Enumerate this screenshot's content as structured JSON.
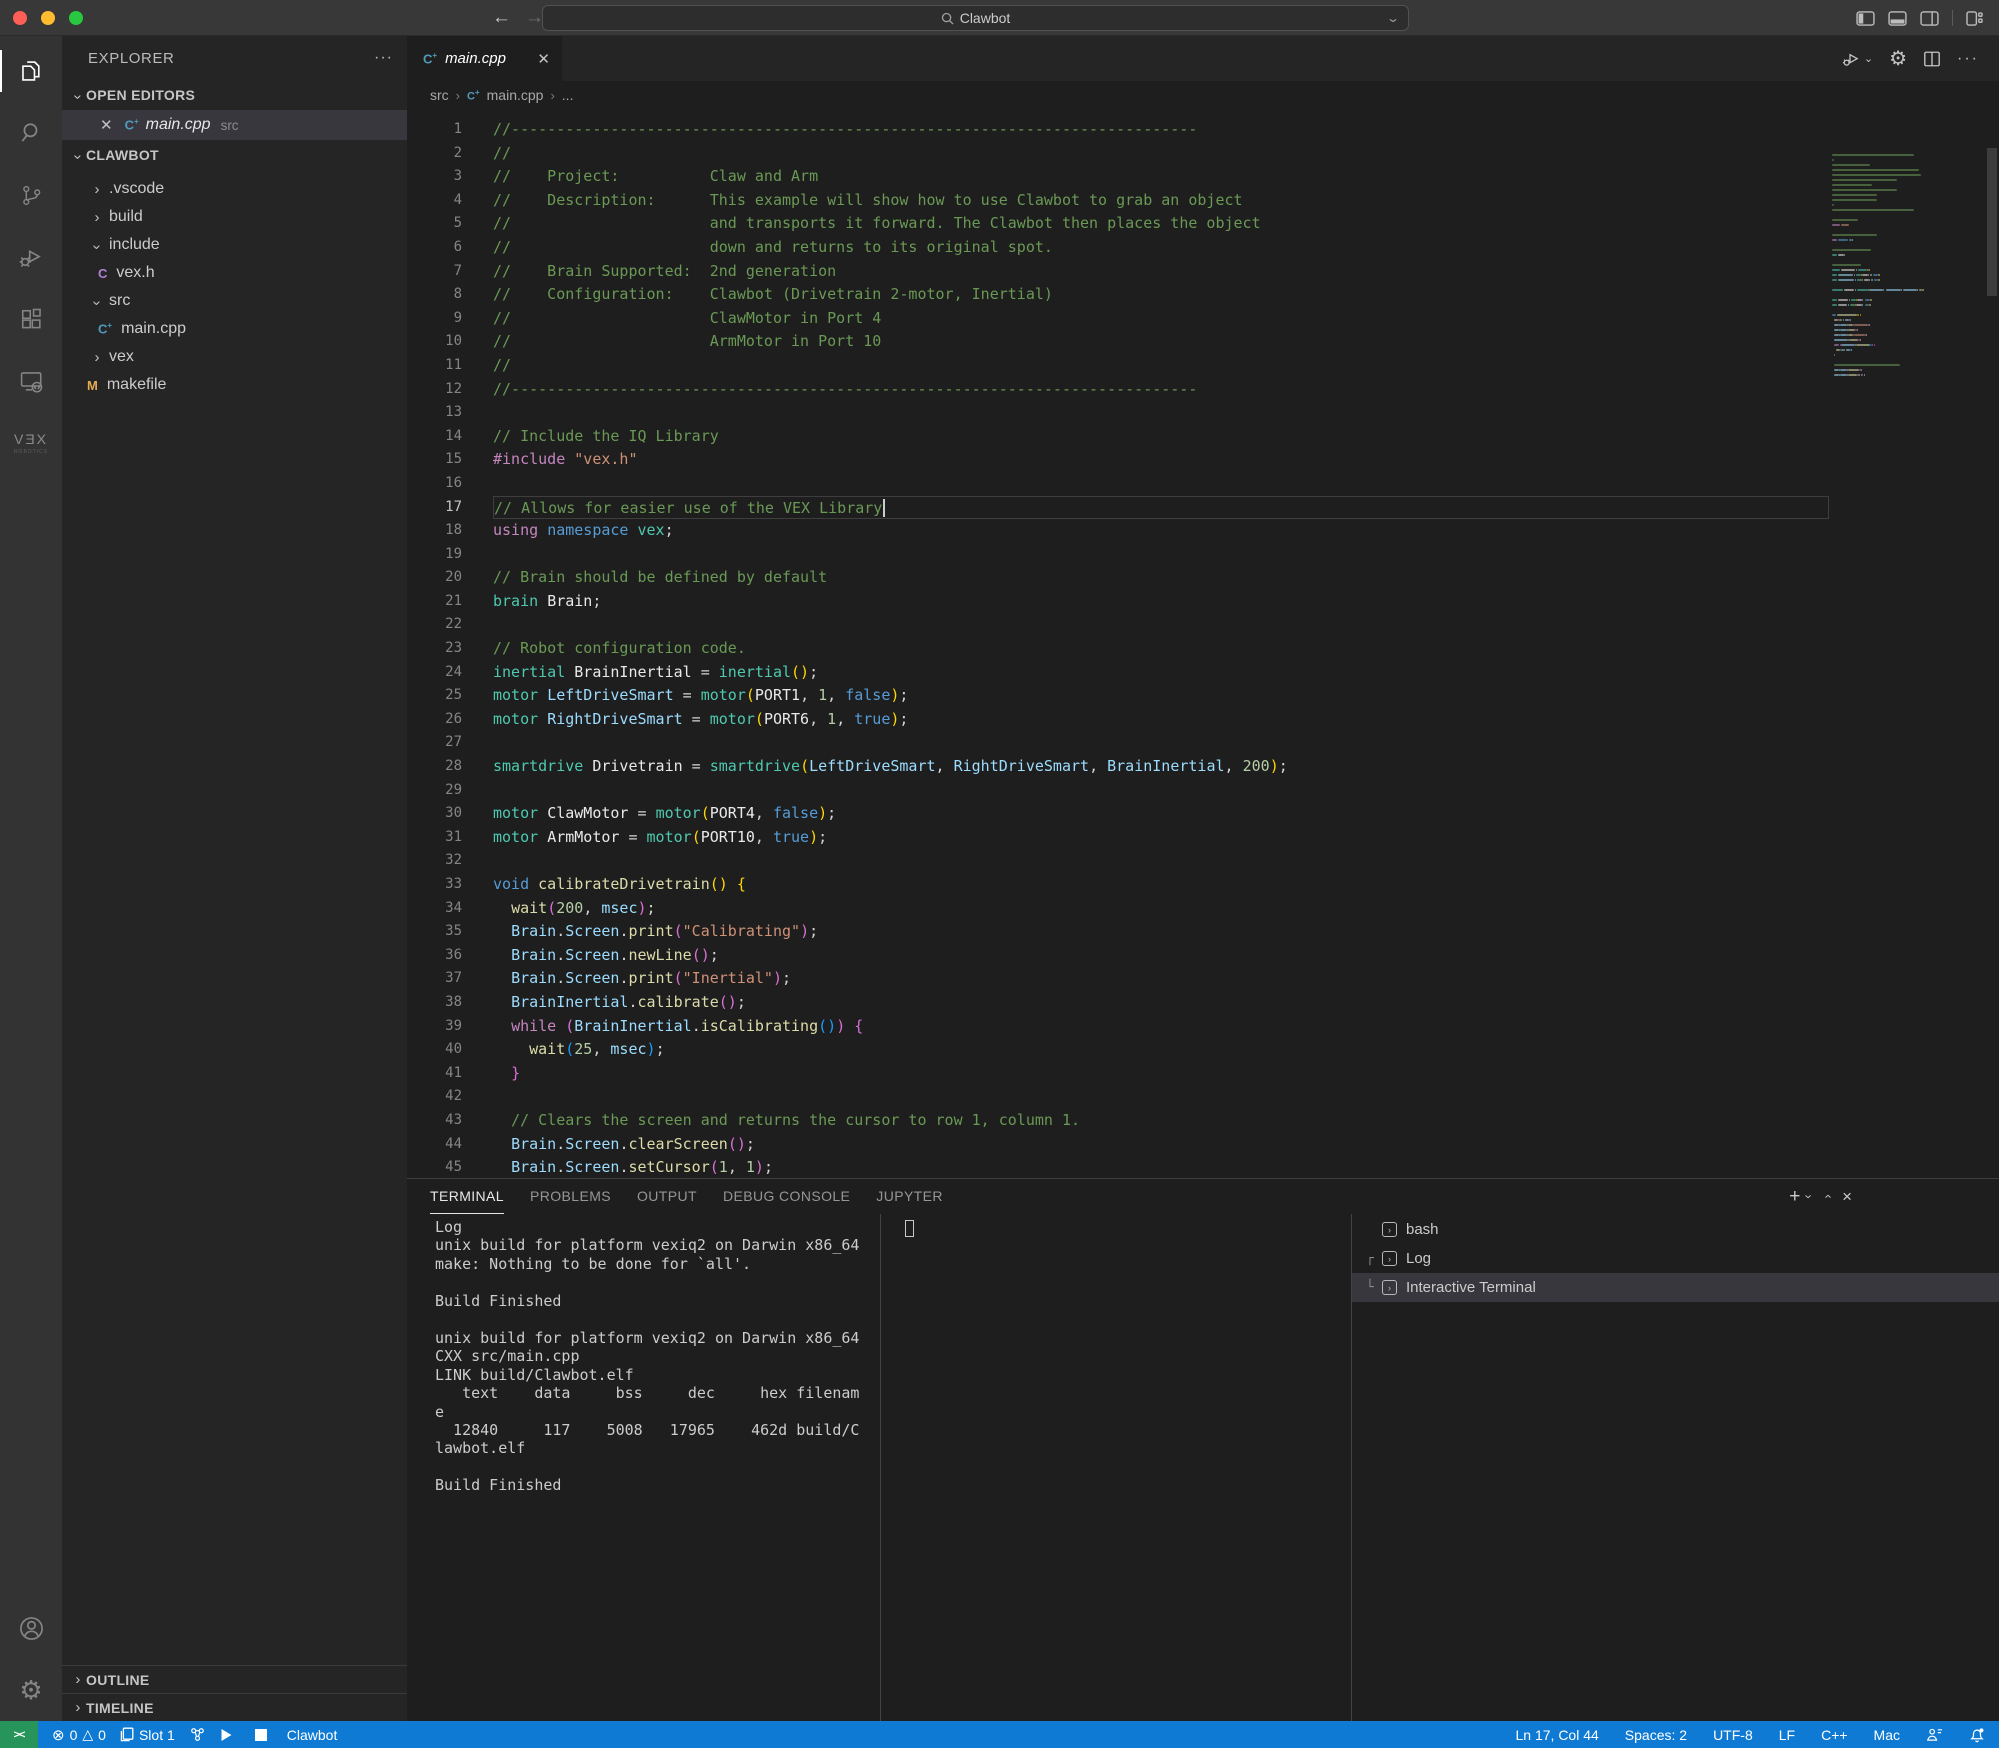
{
  "titlebar": {
    "search_value": "Clawbot"
  },
  "sidebar": {
    "title": "EXPLORER",
    "more_label": "···",
    "sections": {
      "open_editors": "OPEN EDITORS",
      "project": "CLAWBOT",
      "outline": "OUTLINE",
      "timeline": "TIMELINE"
    },
    "open_editor": {
      "file": "main.cpp",
      "path": "src"
    },
    "tree": [
      {
        "label": ".vscode",
        "type": "folder",
        "expanded": false
      },
      {
        "label": "build",
        "type": "folder",
        "expanded": false
      },
      {
        "label": "include",
        "type": "folder",
        "expanded": true
      },
      {
        "label": "vex.h",
        "type": "file",
        "icon": "c",
        "depth": 1
      },
      {
        "label": "src",
        "type": "folder",
        "expanded": true
      },
      {
        "label": "main.cpp",
        "type": "file",
        "icon": "cpp",
        "depth": 1
      },
      {
        "label": "vex",
        "type": "folder",
        "expanded": false
      },
      {
        "label": "makefile",
        "type": "file",
        "icon": "m",
        "depth": 0
      }
    ]
  },
  "editor": {
    "tab": {
      "file": "main.cpp"
    },
    "breadcrumbs": {
      "0": "src",
      "1": "main.cpp",
      "2": "..."
    },
    "cursor_line": 17,
    "lines": [
      [
        [
          "cm",
          "//----------------------------------------------------------------------------"
        ]
      ],
      [
        [
          "cm",
          "//"
        ]
      ],
      [
        [
          "cm",
          "//    Project:          Claw and Arm"
        ]
      ],
      [
        [
          "cm",
          "//    Description:      This example will show how to use Clawbot to grab an object"
        ]
      ],
      [
        [
          "cm",
          "//                      and transports it forward. The Clawbot then places the object"
        ]
      ],
      [
        [
          "cm",
          "//                      down and returns to its original spot."
        ]
      ],
      [
        [
          "cm",
          "//    Brain Supported:  2nd generation"
        ]
      ],
      [
        [
          "cm",
          "//    Configuration:    Clawbot (Drivetrain 2-motor, Inertial)"
        ]
      ],
      [
        [
          "cm",
          "//                      ClawMotor in Port 4"
        ]
      ],
      [
        [
          "cm",
          "//                      ArmMotor in Port 10"
        ]
      ],
      [
        [
          "cm",
          "//"
        ]
      ],
      [
        [
          "cm",
          "//----------------------------------------------------------------------------"
        ]
      ],
      [],
      [
        [
          "cm",
          "// Include the IQ Library"
        ]
      ],
      [
        [
          "kw",
          "#include"
        ],
        [
          "pl",
          " "
        ],
        [
          "st",
          "\"vex.h\""
        ]
      ],
      [],
      [
        [
          "cm",
          "// Allows for easier use of the VEX Library"
        ]
      ],
      [
        [
          "kw",
          "using"
        ],
        [
          "pl",
          " "
        ],
        [
          "kb",
          "namespace"
        ],
        [
          "pl",
          " "
        ],
        [
          "ty",
          "vex"
        ],
        [
          "pl",
          ";"
        ]
      ],
      [],
      [
        [
          "cm",
          "// Brain should be defined by default"
        ]
      ],
      [
        [
          "ty",
          "brain"
        ],
        [
          "pl",
          " "
        ],
        [
          "vw",
          "Brain"
        ],
        [
          "pl",
          ";"
        ]
      ],
      [],
      [
        [
          "cm",
          "// Robot configuration code."
        ]
      ],
      [
        [
          "ty",
          "inertial"
        ],
        [
          "pl",
          " "
        ],
        [
          "vw",
          "BrainInertial"
        ],
        [
          "pl",
          " = "
        ],
        [
          "ty",
          "inertial"
        ],
        [
          "b1",
          "()"
        ],
        [
          "pl",
          ";"
        ]
      ],
      [
        [
          "ty",
          "motor"
        ],
        [
          "pl",
          " "
        ],
        [
          "vb",
          "LeftDriveSmart"
        ],
        [
          "pl",
          " = "
        ],
        [
          "ty",
          "motor"
        ],
        [
          "b1",
          "("
        ],
        [
          "vw",
          "PORT1"
        ],
        [
          "pl",
          ", "
        ],
        [
          "nu",
          "1"
        ],
        [
          "pl",
          ", "
        ],
        [
          "kb",
          "false"
        ],
        [
          "b1",
          ")"
        ],
        [
          "pl",
          ";"
        ]
      ],
      [
        [
          "ty",
          "motor"
        ],
        [
          "pl",
          " "
        ],
        [
          "vb",
          "RightDriveSmart"
        ],
        [
          "pl",
          " = "
        ],
        [
          "ty",
          "motor"
        ],
        [
          "b1",
          "("
        ],
        [
          "vw",
          "PORT6"
        ],
        [
          "pl",
          ", "
        ],
        [
          "nu",
          "1"
        ],
        [
          "pl",
          ", "
        ],
        [
          "kb",
          "true"
        ],
        [
          "b1",
          ")"
        ],
        [
          "pl",
          ";"
        ]
      ],
      [],
      [
        [
          "ty",
          "smartdrive"
        ],
        [
          "pl",
          " "
        ],
        [
          "vw",
          "Drivetrain"
        ],
        [
          "pl",
          " = "
        ],
        [
          "ty",
          "smartdrive"
        ],
        [
          "b1",
          "("
        ],
        [
          "vb",
          "LeftDriveSmart"
        ],
        [
          "pl",
          ", "
        ],
        [
          "vb",
          "RightDriveSmart"
        ],
        [
          "pl",
          ", "
        ],
        [
          "vb",
          "BrainInertial"
        ],
        [
          "pl",
          ", "
        ],
        [
          "nu",
          "200"
        ],
        [
          "b1",
          ")"
        ],
        [
          "pl",
          ";"
        ]
      ],
      [],
      [
        [
          "ty",
          "motor"
        ],
        [
          "pl",
          " "
        ],
        [
          "vw",
          "ClawMotor"
        ],
        [
          "pl",
          " = "
        ],
        [
          "ty",
          "motor"
        ],
        [
          "b1",
          "("
        ],
        [
          "vw",
          "PORT4"
        ],
        [
          "pl",
          ", "
        ],
        [
          "kb",
          "false"
        ],
        [
          "b1",
          ")"
        ],
        [
          "pl",
          ";"
        ]
      ],
      [
        [
          "ty",
          "motor"
        ],
        [
          "pl",
          " "
        ],
        [
          "vw",
          "ArmMotor"
        ],
        [
          "pl",
          " = "
        ],
        [
          "ty",
          "motor"
        ],
        [
          "b1",
          "("
        ],
        [
          "vw",
          "PORT10"
        ],
        [
          "pl",
          ", "
        ],
        [
          "kb",
          "true"
        ],
        [
          "b1",
          ")"
        ],
        [
          "pl",
          ";"
        ]
      ],
      [],
      [
        [
          "kb",
          "void"
        ],
        [
          "pl",
          " "
        ],
        [
          "fn",
          "calibrateDrivetrain"
        ],
        [
          "b1",
          "()"
        ],
        [
          "pl",
          " "
        ],
        [
          "b1",
          "{"
        ]
      ],
      [
        [
          "pl",
          "  "
        ],
        [
          "fn",
          "wait"
        ],
        [
          "b2",
          "("
        ],
        [
          "nu",
          "200"
        ],
        [
          "pl",
          ", "
        ],
        [
          "vb",
          "msec"
        ],
        [
          "b2",
          ")"
        ],
        [
          "pl",
          ";"
        ]
      ],
      [
        [
          "pl",
          "  "
        ],
        [
          "vb",
          "Brain"
        ],
        [
          "pl",
          "."
        ],
        [
          "vb",
          "Screen"
        ],
        [
          "pl",
          "."
        ],
        [
          "fn",
          "print"
        ],
        [
          "b2",
          "("
        ],
        [
          "st",
          "\"Calibrating\""
        ],
        [
          "b2",
          ")"
        ],
        [
          "pl",
          ";"
        ]
      ],
      [
        [
          "pl",
          "  "
        ],
        [
          "vb",
          "Brain"
        ],
        [
          "pl",
          "."
        ],
        [
          "vb",
          "Screen"
        ],
        [
          "pl",
          "."
        ],
        [
          "fn",
          "newLine"
        ],
        [
          "b2",
          "()"
        ],
        [
          "pl",
          ";"
        ]
      ],
      [
        [
          "pl",
          "  "
        ],
        [
          "vb",
          "Brain"
        ],
        [
          "pl",
          "."
        ],
        [
          "vb",
          "Screen"
        ],
        [
          "pl",
          "."
        ],
        [
          "fn",
          "print"
        ],
        [
          "b2",
          "("
        ],
        [
          "st",
          "\"Inertial\""
        ],
        [
          "b2",
          ")"
        ],
        [
          "pl",
          ";"
        ]
      ],
      [
        [
          "pl",
          "  "
        ],
        [
          "vb",
          "BrainInertial"
        ],
        [
          "pl",
          "."
        ],
        [
          "fn",
          "calibrate"
        ],
        [
          "b2",
          "()"
        ],
        [
          "pl",
          ";"
        ]
      ],
      [
        [
          "pl",
          "  "
        ],
        [
          "kw",
          "while"
        ],
        [
          "pl",
          " "
        ],
        [
          "b2",
          "("
        ],
        [
          "vb",
          "BrainInertial"
        ],
        [
          "pl",
          "."
        ],
        [
          "fn",
          "isCalibrating"
        ],
        [
          "b3",
          "()"
        ],
        [
          "b2",
          ")"
        ],
        [
          "pl",
          " "
        ],
        [
          "b2",
          "{"
        ]
      ],
      [
        [
          "pl",
          "    "
        ],
        [
          "fn",
          "wait"
        ],
        [
          "b3",
          "("
        ],
        [
          "nu",
          "25"
        ],
        [
          "pl",
          ", "
        ],
        [
          "vb",
          "msec"
        ],
        [
          "b3",
          ")"
        ],
        [
          "pl",
          ";"
        ]
      ],
      [
        [
          "pl",
          "  "
        ],
        [
          "b2",
          "}"
        ]
      ],
      [],
      [
        [
          "pl",
          "  "
        ],
        [
          "cm",
          "// Clears the screen and returns the cursor to row 1, column 1."
        ]
      ],
      [
        [
          "pl",
          "  "
        ],
        [
          "vb",
          "Brain"
        ],
        [
          "pl",
          "."
        ],
        [
          "vb",
          "Screen"
        ],
        [
          "pl",
          "."
        ],
        [
          "fn",
          "clearScreen"
        ],
        [
          "b2",
          "()"
        ],
        [
          "pl",
          ";"
        ]
      ],
      [
        [
          "pl",
          "  "
        ],
        [
          "vb",
          "Brain"
        ],
        [
          "pl",
          "."
        ],
        [
          "vb",
          "Screen"
        ],
        [
          "pl",
          "."
        ],
        [
          "fn",
          "setCursor"
        ],
        [
          "b2",
          "("
        ],
        [
          "nu",
          "1"
        ],
        [
          "pl",
          ", "
        ],
        [
          "nu",
          "1"
        ],
        [
          "b2",
          ")"
        ],
        [
          "pl",
          ";"
        ]
      ]
    ]
  },
  "panel": {
    "tabs": [
      "TERMINAL",
      "PROBLEMS",
      "OUTPUT",
      "DEBUG CONSOLE",
      "JUPYTER"
    ],
    "active_tab": "TERMINAL",
    "terminal_output": [
      "Log",
      "unix build for platform vexiq2 on Darwin x86_64",
      "make: Nothing to be done for `all'.",
      "",
      "Build Finished",
      "",
      "unix build for platform vexiq2 on Darwin x86_64",
      "CXX src/main.cpp",
      "LINK build/Clawbot.elf",
      "   text    data     bss     dec     hex filenam",
      "e",
      "  12840     117    5008   17965    462d build/C",
      "lawbot.elf",
      "",
      "Build Finished"
    ],
    "terminals": [
      {
        "label": "bash",
        "prefix": "",
        "selected": false
      },
      {
        "label": "Log",
        "prefix": "┌",
        "selected": false
      },
      {
        "label": "Interactive Terminal",
        "prefix": "└",
        "selected": true
      }
    ]
  },
  "status_bar": {
    "errors": "0",
    "warnings": "0",
    "slot": "Slot 1",
    "app": "Clawbot",
    "right": [
      "Ln 17, Col 44",
      "Spaces: 2",
      "UTF-8",
      "LF",
      "C++",
      "Mac"
    ]
  }
}
